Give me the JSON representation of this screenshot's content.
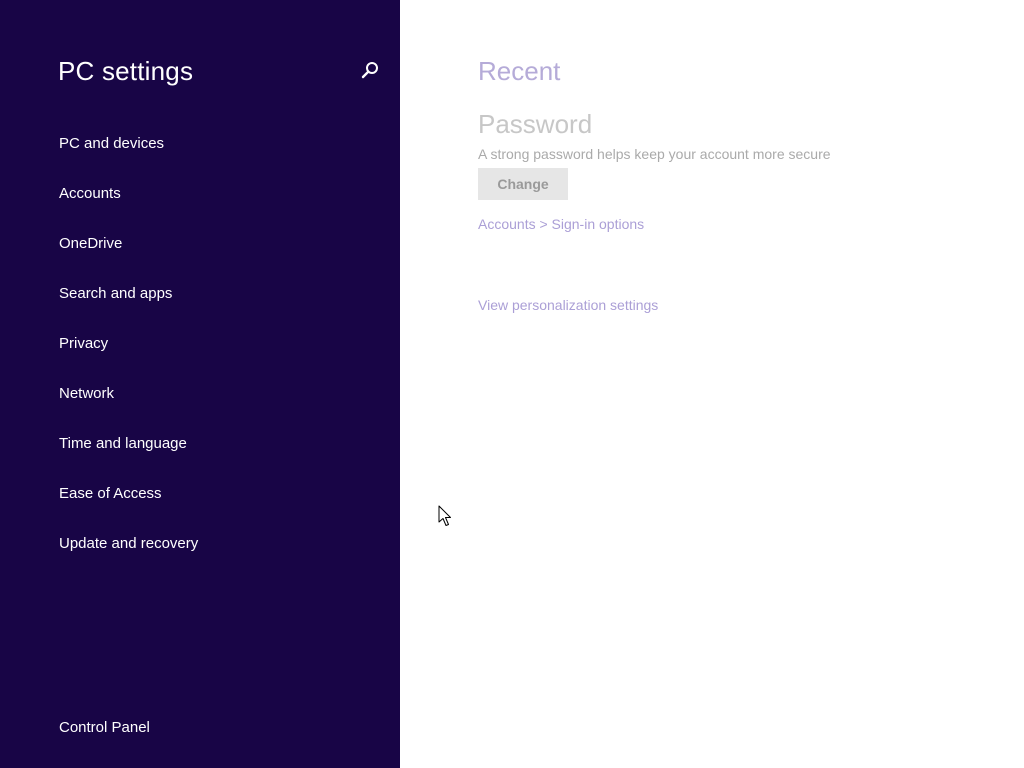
{
  "sidebar": {
    "title": "PC settings",
    "search_icon": "search-icon",
    "items": [
      {
        "label": "PC and devices"
      },
      {
        "label": "Accounts"
      },
      {
        "label": "OneDrive"
      },
      {
        "label": "Search and apps"
      },
      {
        "label": "Privacy"
      },
      {
        "label": "Network"
      },
      {
        "label": "Time and language"
      },
      {
        "label": "Ease of Access"
      },
      {
        "label": "Update and recovery"
      }
    ],
    "footer_link": "Control Panel"
  },
  "main": {
    "heading": "Recent",
    "password": {
      "title": "Password",
      "description": "A strong password helps keep your account more secure",
      "button_label": "Change",
      "breadcrumb_link": "Accounts > Sign-in options"
    },
    "personalization_link": "View personalization settings"
  },
  "colors": {
    "sidebar_bg": "#180546",
    "accent": "#ab9fd6",
    "button_bg": "#e6e6e6"
  }
}
